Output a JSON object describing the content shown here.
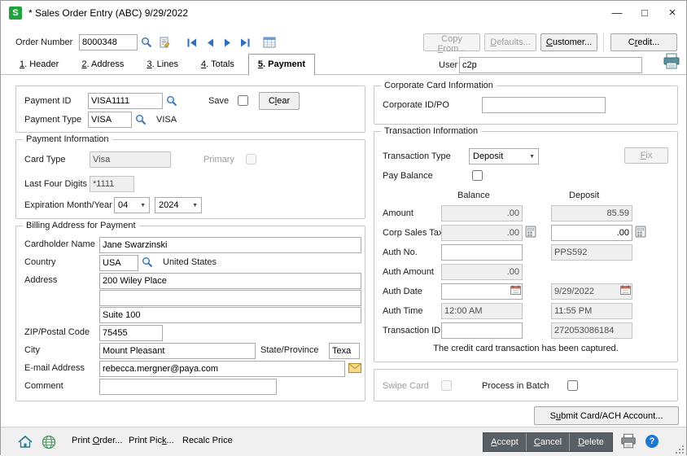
{
  "window": {
    "title": "* Sales Order Entry (ABC) 9/29/2022",
    "logo_letter": "S"
  },
  "icons": {
    "minimize": "—",
    "maximize": "□",
    "close": "×",
    "chevron_down": "▼",
    "help": "?"
  },
  "colors": {
    "logo_green": "#1fa33c",
    "nav_arrow_blue": "#2f6fc1",
    "help_blue": "#1976d2",
    "dark_button_gray": "#5a5f64"
  },
  "toolbar": {
    "order_number_label": "Order Number",
    "order_number_value": "8000348",
    "copy_from": {
      "pre": "Copy ",
      "key": "F",
      "post": "rom..."
    },
    "defaults": {
      "pre": "",
      "key": "D",
      "post": "efaults..."
    },
    "customer": {
      "pre": "",
      "key": "C",
      "post": "ustomer..."
    },
    "credit": {
      "pre": "C",
      "key": "r",
      "post": "edit..."
    },
    "user_label": "User",
    "user_value": "c2p"
  },
  "tabs": [
    {
      "num": "1",
      "rest": ". Header"
    },
    {
      "num": "2",
      "rest": ". Address"
    },
    {
      "num": "3",
      "rest": ". Lines"
    },
    {
      "num": "4",
      "rest": ". Totals"
    },
    {
      "num": "5",
      "rest": ". Payment"
    }
  ],
  "payment": {
    "payment_id_label": "Payment ID",
    "payment_id_value": "VISA1111",
    "save_label": "Save",
    "clear": {
      "pre": "C",
      "key": "l",
      "post": "ear"
    },
    "payment_type_label": "Payment Type",
    "payment_type_value": "VISA",
    "payment_type_desc": "VISA"
  },
  "payment_info": {
    "title": "Payment Information",
    "card_type_label": "Card Type",
    "card_type_value": "Visa",
    "primary_label": "Primary",
    "last_four_label": "Last Four Digits",
    "last_four_value": "*1111",
    "expiration_label": "Expiration Month/Year",
    "exp_month": "04",
    "exp_year": "2024"
  },
  "billing": {
    "title": "Billing Address for Payment",
    "cardholder_label": "Cardholder Name",
    "cardholder_value": "Jane Swarzinski",
    "country_label": "Country",
    "country_code": "USA",
    "country_name": "United States",
    "address_label": "Address",
    "address_line1": "200 Wiley Place",
    "address_line2": "",
    "address_line3": "Suite 100",
    "zip_label": "ZIP/Postal Code",
    "zip_value": "75455",
    "city_label": "City",
    "city_value": "Mount Pleasant",
    "state_label": "State/Province",
    "state_value": "Texa",
    "email_label": "E-mail Address",
    "email_value": "rebecca.mergner@paya.com",
    "comment_label": "Comment",
    "comment_value": ""
  },
  "corporate": {
    "title": "Corporate Card Information",
    "id_label": "Corporate ID/PO",
    "id_value": ""
  },
  "transaction": {
    "title": "Transaction Information",
    "type_label": "Transaction Type",
    "type_value": "Deposit",
    "fix": {
      "pre": "",
      "key": "F",
      "post": "ix"
    },
    "pay_balance_label": "Pay Balance",
    "balance_header": "Balance",
    "deposit_header": "Deposit",
    "rows": [
      {
        "label": "Amount",
        "balance": ".00",
        "deposit": "85.59"
      },
      {
        "label": "Corp Sales Tax",
        "balance": ".00",
        "deposit": ".00"
      },
      {
        "label": "Auth No.",
        "balance": "",
        "deposit": "PPS592"
      },
      {
        "label": "Auth Amount",
        "balance": ".00",
        "deposit": null
      },
      {
        "label": "Auth Date",
        "balance": "",
        "deposit": "9/29/2022"
      },
      {
        "label": "Auth Time",
        "balance": "12:00 AM",
        "deposit": "11:55 PM"
      },
      {
        "label": "Transaction ID",
        "balance": "",
        "deposit": "272053086184"
      }
    ],
    "captured_message": "The credit card transaction has been captured."
  },
  "options": {
    "swipe_label": "Swipe Card",
    "batch_label": "Process in Batch"
  },
  "submit": {
    "pre": "S",
    "key": "u",
    "post": "bmit Card/ACH Account..."
  },
  "statusbar": {
    "print_order": {
      "pre": "Print ",
      "key": "O",
      "post": "rder..."
    },
    "print_pick": {
      "pre": "Print Pic",
      "key": "k",
      "post": "..."
    },
    "recalc_price": {
      "pre": "Recalc Price",
      "key": "",
      "post": ""
    },
    "accept": {
      "pre": "",
      "key": "A",
      "post": "ccept"
    },
    "cancel": {
      "pre": "",
      "key": "C",
      "post": "ancel"
    },
    "delete": {
      "pre": "",
      "key": "D",
      "post": "elete"
    }
  }
}
